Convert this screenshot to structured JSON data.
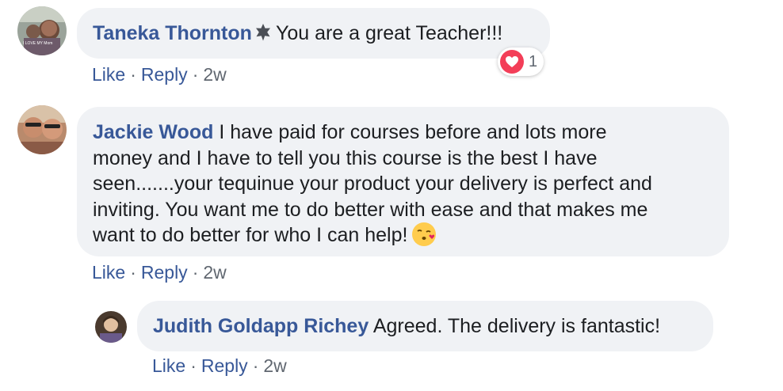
{
  "comments": [
    {
      "author": "Taneka Thornton",
      "text": "You are a great Teacher!!!",
      "actions": {
        "like": "Like",
        "reply": "Reply",
        "sep": "·",
        "time": "2w"
      },
      "reaction": {
        "type": "love-icon",
        "count": "1"
      },
      "avatar_text": "I LOVE MY Mom"
    },
    {
      "author": "Jackie Wood",
      "text_lines": [
        "I have paid for courses before and lots more",
        "money and I have to tell you this course is the best I have",
        "seen.......your tequinue your product your delivery is perfect and",
        "inviting. You want me to do better with ease and that makes me",
        "want to do better for who I can help!"
      ],
      "emoji": "kissing-face-icon",
      "actions": {
        "like": "Like",
        "reply": "Reply",
        "sep": "·",
        "time": "2w"
      }
    },
    {
      "author": "Judith Goldapp Richey",
      "text": "Agreed. The delivery is fantastic!",
      "actions": {
        "like": "Like",
        "reply": "Reply",
        "sep": "·",
        "time": "2w"
      }
    }
  ],
  "colors": {
    "name": "#385898",
    "bubble": "#f0f2f5",
    "meta": "#606770",
    "heart": "#f33e58"
  }
}
